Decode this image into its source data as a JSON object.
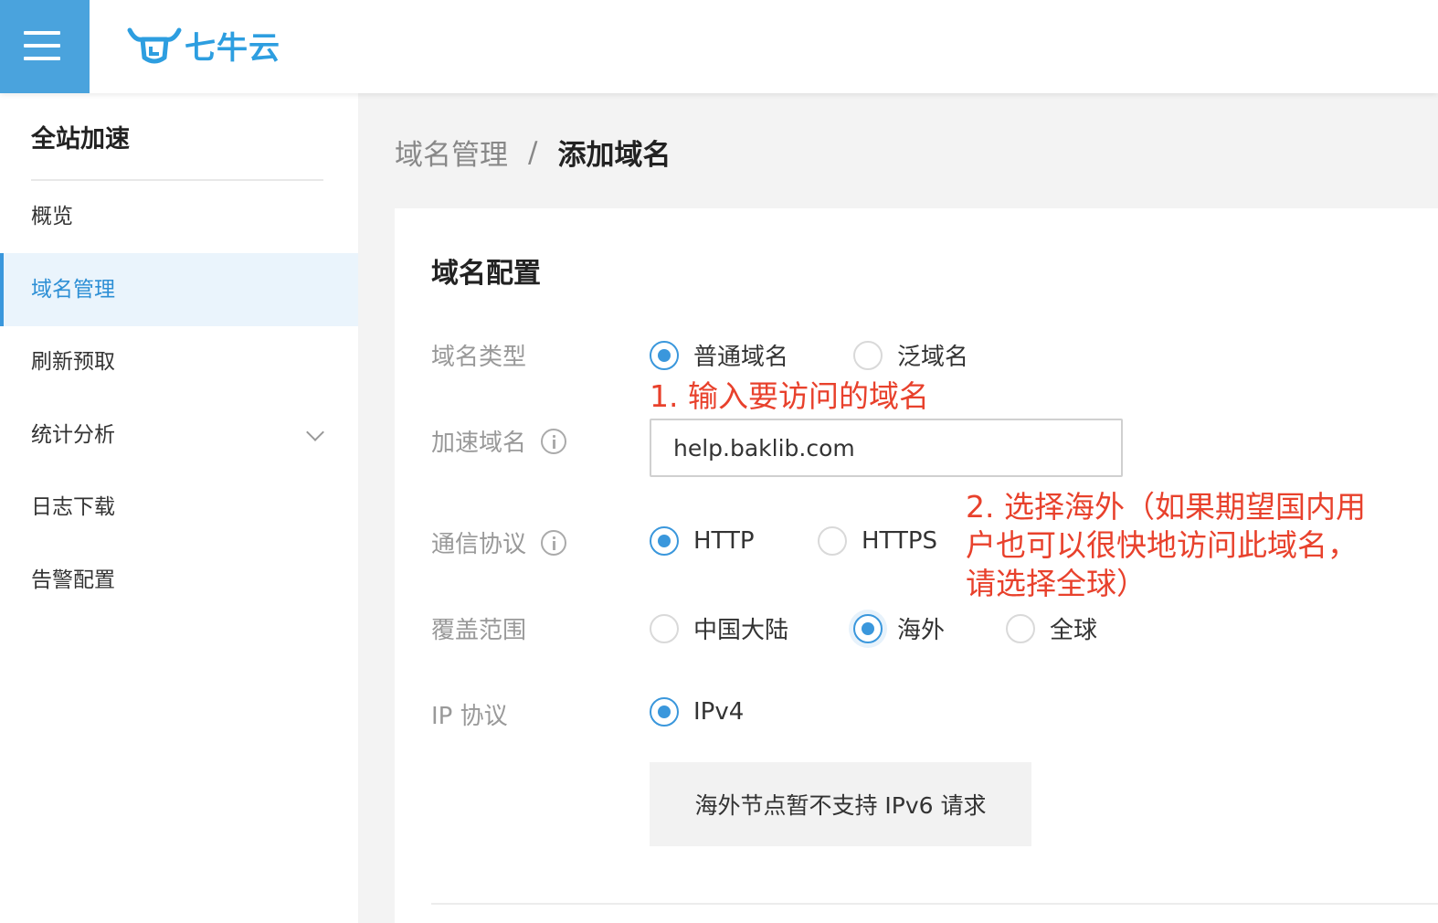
{
  "header": {
    "brand_text": "七牛云",
    "accent_color": "#4aa3dd"
  },
  "sidebar": {
    "title": "全站加速",
    "items": [
      {
        "label": "概览",
        "active": false
      },
      {
        "label": "域名管理",
        "active": true
      },
      {
        "label": "刷新预取",
        "active": false
      },
      {
        "label": "统计分析",
        "active": false,
        "expandable": true
      },
      {
        "label": "日志下载",
        "active": false
      },
      {
        "label": "告警配置",
        "active": false
      }
    ]
  },
  "breadcrumb": {
    "parent": "域名管理",
    "separator": "/",
    "current": "添加域名"
  },
  "form": {
    "section_title": "域名配置",
    "domain_type": {
      "label": "域名类型",
      "options": [
        "普通域名",
        "泛域名"
      ],
      "selected": "普通域名"
    },
    "domain_name": {
      "label": "加速域名",
      "value": "help.baklib.com"
    },
    "protocol": {
      "label": "通信协议",
      "options": [
        "HTTP",
        "HTTPS"
      ],
      "selected": "HTTP"
    },
    "coverage": {
      "label": "覆盖范围",
      "options": [
        "中国大陆",
        "海外",
        "全球"
      ],
      "selected": "海外"
    },
    "ip_protocol": {
      "label": "IP 协议",
      "options": [
        "IPv4"
      ],
      "selected": "IPv4"
    },
    "notice": "海外节点暂不支持 IPv6 请求"
  },
  "annotations": {
    "step1": "1. 输入要访问的域名",
    "step2_line1": "2. 选择海外（如果期望国内用",
    "step2_line2": "户也可以很快地访问此域名，",
    "step2_line3": "请选择全球）",
    "color": "#e8412c"
  }
}
